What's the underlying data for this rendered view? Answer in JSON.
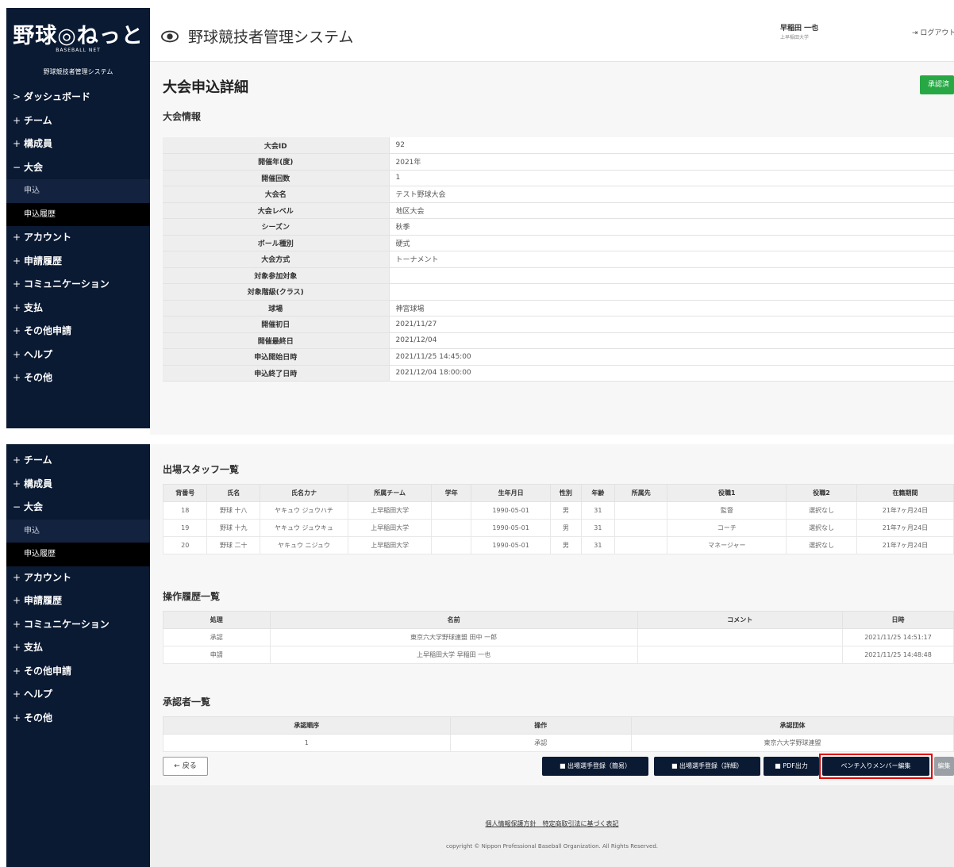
{
  "sidebar": {
    "logo_text": "野球◎ねっと",
    "logo_sub": "BASEBALL NET",
    "system_name": "野球競技者管理システム",
    "menu_top": [
      {
        "sym": ">",
        "label": "ダッシュボード",
        "sub": false,
        "active": false
      },
      {
        "sym": "+",
        "label": "チーム",
        "sub": false,
        "active": false
      },
      {
        "sym": "+",
        "label": "構成員",
        "sub": false,
        "active": false
      },
      {
        "sym": "−",
        "label": "大会",
        "sub": false,
        "active": false
      },
      {
        "sym": "",
        "label": "申込",
        "sub": true,
        "active": false
      },
      {
        "sym": "",
        "label": "申込履歴",
        "sub": true,
        "active": true
      },
      {
        "sym": "+",
        "label": "アカウント",
        "sub": false,
        "active": false
      },
      {
        "sym": "+",
        "label": "申請履歴",
        "sub": false,
        "active": false
      },
      {
        "sym": "+",
        "label": "コミュニケーション",
        "sub": false,
        "active": false
      },
      {
        "sym": "+",
        "label": "支払",
        "sub": false,
        "active": false
      },
      {
        "sym": "+",
        "label": "その他申請",
        "sub": false,
        "active": false
      },
      {
        "sym": "+",
        "label": "ヘルプ",
        "sub": false,
        "active": false
      },
      {
        "sym": "+",
        "label": "その他",
        "sub": false,
        "active": false
      }
    ],
    "menu_bottom": [
      {
        "sym": "+",
        "label": "チーム",
        "sub": false,
        "active": false
      },
      {
        "sym": "+",
        "label": "構成員",
        "sub": false,
        "active": false
      },
      {
        "sym": "−",
        "label": "大会",
        "sub": false,
        "active": false
      },
      {
        "sym": "",
        "label": "申込",
        "sub": true,
        "active": false
      },
      {
        "sym": "",
        "label": "申込履歴",
        "sub": true,
        "active": true
      },
      {
        "sym": "+",
        "label": "アカウント",
        "sub": false,
        "active": false
      },
      {
        "sym": "+",
        "label": "申請履歴",
        "sub": false,
        "active": false
      },
      {
        "sym": "+",
        "label": "コミュニケーション",
        "sub": false,
        "active": false
      },
      {
        "sym": "+",
        "label": "支払",
        "sub": false,
        "active": false
      },
      {
        "sym": "+",
        "label": "その他申請",
        "sub": false,
        "active": false
      },
      {
        "sym": "+",
        "label": "ヘルプ",
        "sub": false,
        "active": false
      },
      {
        "sym": "+",
        "label": "その他",
        "sub": false,
        "active": false
      }
    ]
  },
  "header": {
    "title": "野球競技者管理システム",
    "user_name": "早稲田 一也",
    "user_org": "上早稲田大学",
    "logout": "ログアウト"
  },
  "page": {
    "title": "大会申込詳細",
    "approve_button": "承認済"
  },
  "tournament": {
    "heading": "大会情報",
    "rows": [
      {
        "k": "大会ID",
        "v": "92"
      },
      {
        "k": "開催年(度)",
        "v": "2021年"
      },
      {
        "k": "開催回数",
        "v": "1"
      },
      {
        "k": "大会名",
        "v": "テスト野球大会"
      },
      {
        "k": "大会レベル",
        "v": "地区大会"
      },
      {
        "k": "シーズン",
        "v": "秋季"
      },
      {
        "k": "ボール種別",
        "v": "硬式"
      },
      {
        "k": "大会方式",
        "v": "トーナメント"
      },
      {
        "k": "対象参加対象",
        "v": ""
      },
      {
        "k": "対象階級(クラス)",
        "v": ""
      },
      {
        "k": "球場",
        "v": "神宮球場"
      },
      {
        "k": "開催初日",
        "v": "2021/11/27"
      },
      {
        "k": "開催最終日",
        "v": "2021/12/04"
      },
      {
        "k": "申込開始日時",
        "v": "2021/11/25 14:45:00"
      },
      {
        "k": "申込終了日時",
        "v": "2021/12/04 18:00:00"
      }
    ]
  },
  "staff": {
    "heading": "出場スタッフ一覧",
    "columns": [
      "背番号",
      "氏名",
      "氏名カナ",
      "所属チーム",
      "学年",
      "生年月日",
      "性別",
      "年齢",
      "所属先",
      "役職1",
      "役職2",
      "在籍期間"
    ],
    "rows": [
      [
        "18",
        "野球 十八",
        "ヤキュウ ジュウハチ",
        "上早稲田大学",
        "",
        "1990-05-01",
        "男",
        "31",
        "",
        "監督",
        "選択なし",
        "21年7ヶ月24日"
      ],
      [
        "19",
        "野球 十九",
        "ヤキュウ ジュウキュ",
        "上早稲田大学",
        "",
        "1990-05-01",
        "男",
        "31",
        "",
        "コーチ",
        "選択なし",
        "21年7ヶ月24日"
      ],
      [
        "20",
        "野球 二十",
        "ヤキュウ ニジュウ",
        "上早稲田大学",
        "",
        "1990-05-01",
        "男",
        "31",
        "",
        "マネージャー",
        "選択なし",
        "21年7ヶ月24日"
      ]
    ]
  },
  "history": {
    "heading": "操作履歴一覧",
    "columns": [
      "処理",
      "名前",
      "コメント",
      "日時"
    ],
    "rows": [
      [
        "承認",
        "東京六大学野球連盟 田中 一郎",
        "",
        "2021/11/25 14:51:17"
      ],
      [
        "申請",
        "上早稲田大学 早稲田 一也",
        "",
        "2021/11/25 14:48:48"
      ]
    ]
  },
  "approvers": {
    "heading": "承認者一覧",
    "columns": [
      "承認順序",
      "操作",
      "承認団体"
    ],
    "rows": [
      [
        "1",
        "承認",
        "東京六大学野球連盟"
      ]
    ]
  },
  "actions": {
    "back": "← 戻る",
    "b1": "■ 出場選手登録（簡易）",
    "b2": "■ 出場選手登録（詳細）",
    "b3": "■ PDF出力",
    "b4": "ベンチ入りメンバー編集",
    "b5": "編集"
  },
  "footer": {
    "links": "個人情報保護方針　特定商取引法に基づく表記",
    "copyright": "copyright © Nippon Professional Baseball Organization. All Rights Reserved."
  }
}
